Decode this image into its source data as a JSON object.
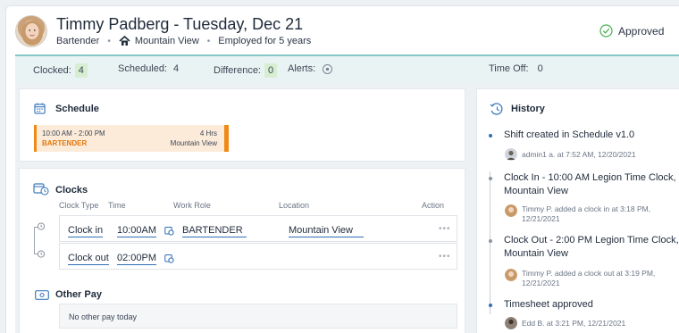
{
  "header": {
    "title": "Timmy Padberg - Tuesday, Dec 21",
    "role": "Bartender",
    "location": "Mountain View",
    "tenure": "Employed for 5 years",
    "status": "Approved",
    "separator": "•"
  },
  "summary": {
    "clocked_label": "Clocked:",
    "clocked_value": "4",
    "scheduled_label": "Scheduled:",
    "scheduled_value": "4",
    "difference_label": "Difference:",
    "difference_value": "0",
    "alerts_label": "Alerts:",
    "timeoff_label": "Time Off:",
    "timeoff_value": "0"
  },
  "schedule": {
    "title": "Schedule",
    "shift_time": "10:00 AM - 2:00 PM",
    "shift_hours": "4 Hrs",
    "shift_role": "BARTENDER",
    "shift_location": "Mountain View"
  },
  "clocks": {
    "title": "Clocks",
    "columns": [
      "Clock Type",
      "Time",
      "Work Role",
      "Location",
      "Action"
    ],
    "rows": [
      {
        "type": "Clock in",
        "time": "10:00AM",
        "role": "BARTENDER",
        "location": "Mountain View",
        "action": "•••"
      },
      {
        "type": "Clock out",
        "time": "02:00PM",
        "role": "",
        "location": "",
        "action": "•••"
      }
    ]
  },
  "other_pay": {
    "title": "Other Pay",
    "empty": "No other pay today"
  },
  "history": {
    "title": "History",
    "items": [
      {
        "main": "Shift created in Schedule v1.0",
        "sub": "admin1 a. at 7:52 AM, 12/20/2021"
      },
      {
        "main_bold": "Clock In - 10:00 AM",
        "main_rest": " Legion Time Clock, Mountain View",
        "sub": "Timmy P. added a clock in at 3:18 PM, 12/21/2021"
      },
      {
        "main_bold": "Clock Out - 2:00 PM",
        "main_rest": " Legion Time Clock, Mountain View",
        "sub": "Timmy P. added a clock out at 3:19 PM, 12/21/2021"
      },
      {
        "main": "Timesheet approved",
        "sub": "Edd B. at 3:21 PM, 12/21/2021"
      }
    ]
  },
  "colors": {
    "accent": "#2f6eb4",
    "shift_orange": "#f08a16",
    "summary_bg": "#e9f3f3",
    "badge_green": "#d8eed2",
    "approved_green": "#4caf50"
  }
}
